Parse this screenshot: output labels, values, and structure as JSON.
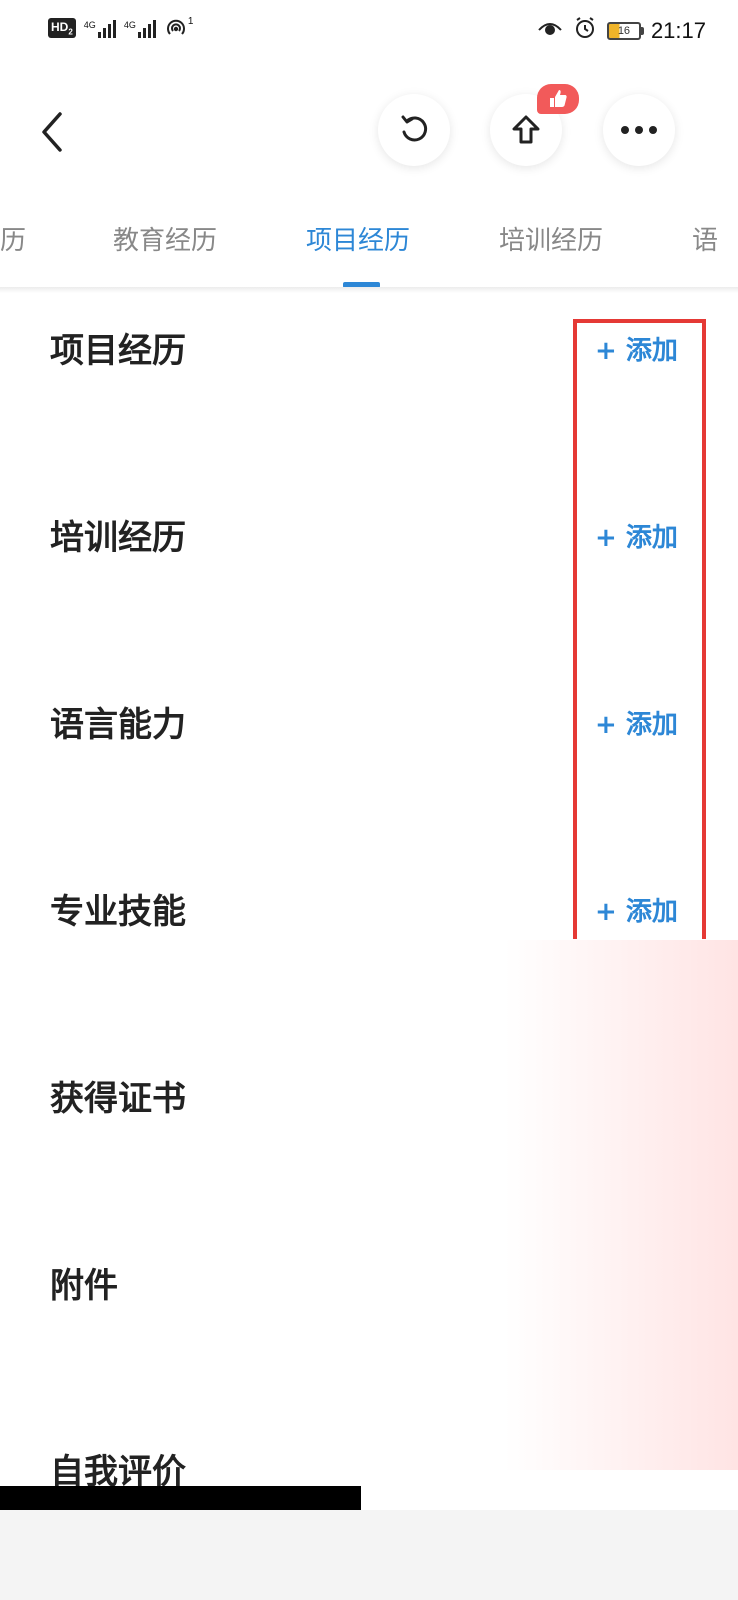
{
  "status_bar": {
    "hd_label": "HD",
    "hd_sub": "2",
    "signal1_label": "4G",
    "signal2_label": "4G",
    "hotspot_count": "1",
    "battery_level": "16",
    "time": "21:17"
  },
  "nav": {
    "back_icon": "chevron-left-icon",
    "refresh_icon": "refresh-icon",
    "share_icon": "share-up-icon",
    "more_icon": "more-dots-icon",
    "like_icon": "thumbs-up-icon",
    "like_badge_color": "#f25a5a"
  },
  "tabs": [
    {
      "label": "经历",
      "partial": "历",
      "active": false
    },
    {
      "label": "教育经历",
      "active": false
    },
    {
      "label": "项目经历",
      "active": true
    },
    {
      "label": "培训经历",
      "active": false
    },
    {
      "label": "语言能力",
      "partial": "语",
      "active": false
    }
  ],
  "sections": [
    {
      "title": "项目经历",
      "action": "+ 添加"
    },
    {
      "title": "培训经历",
      "action": "+ 添加"
    },
    {
      "title": "语言能力",
      "action": "+ 添加"
    },
    {
      "title": "专业技能",
      "action": "+ 添加"
    },
    {
      "title": "获得证书",
      "action": ""
    },
    {
      "title": "附件",
      "action": ""
    },
    {
      "title": "自我评价",
      "action": ""
    }
  ],
  "colors": {
    "accent": "#2d87d6",
    "highlight_box": "#e53935",
    "title_text": "#222222"
  }
}
